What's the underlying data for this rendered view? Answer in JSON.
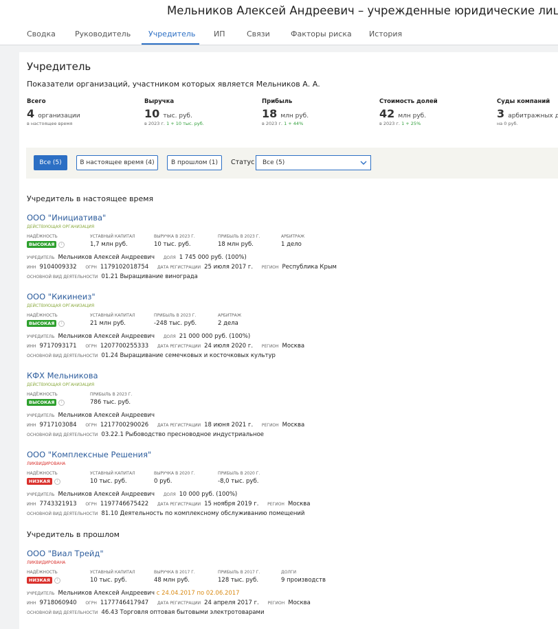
{
  "header": {
    "title": "Мельников Алексей Андреевич – учрежденные юридические лица"
  },
  "tabs": [
    {
      "label": "Сводка"
    },
    {
      "label": "Руководитель"
    },
    {
      "label": "Учредитель"
    },
    {
      "label": "ИП"
    },
    {
      "label": "Связи"
    },
    {
      "label": "Факторы риска"
    },
    {
      "label": "История"
    }
  ],
  "section": {
    "title": "Учредитель",
    "subtitle": "Показатели организаций, участником которых является Мельников А. А."
  },
  "stats": [
    {
      "label": "Всего",
      "value": "4",
      "unit": "организации",
      "note": "в настоящее время",
      "note_green": ""
    },
    {
      "label": "Выручка",
      "value": "10",
      "unit": "тыс. руб.",
      "note": "в 2023 г.",
      "note_green": "1 + 10 тыс. руб."
    },
    {
      "label": "Прибыль",
      "value": "18",
      "unit": "млн руб.",
      "note": "в 2023 г.",
      "note_green": "1 + 44%"
    },
    {
      "label": "Стоимость долей",
      "value": "42",
      "unit": "млн руб.",
      "note": "в 2023 г.",
      "note_green": "1 + 25%"
    },
    {
      "label": "Суды компаний",
      "value": "3",
      "unit": "арбитражных дела",
      "note": "на 0 руб.",
      "note_green": ""
    }
  ],
  "filters": {
    "buttons": [
      {
        "label": "Все (5)"
      },
      {
        "label": "В настоящее время (4)"
      },
      {
        "label": "В прошлом (1)"
      }
    ],
    "status_label": "Статус",
    "status_value": "Все (5)"
  },
  "headings": {
    "current": "Учредитель в настоящее время",
    "past": "Учредитель в прошлом"
  },
  "labels": {
    "reliability": "Надёжность",
    "capital": "Уставный капитал",
    "founder": "Учредитель",
    "share": "Доля",
    "inn": "ИНН",
    "ogrn": "ОГРН",
    "reg_date": "Дата регистрации",
    "region": "Регион",
    "activity": "Основной вид деятельности",
    "arbitration": "Арбитраж",
    "debts": "Долги"
  },
  "companies": [
    {
      "name": "ООО \"Инициатива\"",
      "status": "Действующая организация",
      "reliability": "Высокая",
      "capital": "1,7 млн руб.",
      "rev_label": "Выручка в 2023 г.",
      "revenue": "10 тыс. руб.",
      "profit_label": "Прибыль в 2023 г.",
      "profit": "18 млн руб.",
      "extra_value": "1 дело",
      "founder": "Мельников Алексей Андреевич",
      "share": "1 745 000 руб. (100%)",
      "inn": "9104009332",
      "ogrn": "1179102018754",
      "reg_date": "25 июля 2017 г.",
      "region": "Республика Крым",
      "activity": "01.21 Выращивание винограда"
    },
    {
      "name": "ООО \"Кикинеиз\"",
      "status": "Действующая организация",
      "reliability": "Высокая",
      "capital": "21 млн руб.",
      "profit_label": "Прибыль в 2023 г.",
      "profit": "-248 тыс. руб.",
      "extra_value": "2 дела",
      "founder": "Мельников Алексей Андреевич",
      "share": "21 000 000 руб. (100%)",
      "inn": "9717093171",
      "ogrn": "1207700255333",
      "reg_date": "24 июля 2020 г.",
      "region": "Москва",
      "activity": "01.24 Выращивание семечковых и косточковых культур"
    },
    {
      "name": "КФХ Мельникова",
      "status": "Действующая организация",
      "reliability": "Высокая",
      "profit_label": "Прибыль в 2023 г.",
      "profit": "786 тыс. руб.",
      "founder": "Мельников Алексей Андреевич",
      "inn": "9717103084",
      "ogrn": "1217700290026",
      "reg_date": "18 июня 2021 г.",
      "region": "Москва",
      "activity": "03.22.1 Рыбоводство пресноводное индустриальное"
    },
    {
      "name": "ООО \"Комплексные Решения\"",
      "status": "Ликвидирована",
      "reliability": "Низкая",
      "capital": "10 тыс. руб.",
      "rev_label": "Выручка в 2020 г.",
      "revenue": "0 руб.",
      "profit_label": "Прибыль в 2020 г.",
      "profit": "-8,0 тыс. руб.",
      "founder": "Мельников Алексей Андреевич",
      "share": "10 000 руб. (100%)",
      "inn": "7743321913",
      "ogrn": "1197746675422",
      "reg_date": "15 ноября 2019 г.",
      "region": "Москва",
      "activity": "81.10 Деятельность по комплексному обслуживанию помещений"
    },
    {
      "name": "ООО \"Виал Трейд\"",
      "status": "Ликвидирована",
      "reliability": "Низкая",
      "capital": "10 тыс. руб.",
      "rev_label": "Выручка в 2017 г.",
      "revenue": "48 млн руб.",
      "profit_label": "Прибыль в 2017 г.",
      "profit": "128 тыс. руб.",
      "extra_value": "9 производств",
      "founder": "Мельников Алексей Андреевич",
      "founder_period": "с 24.04.2017 по 02.06.2017",
      "inn": "9718060940",
      "ogrn": "1177746417947",
      "reg_date": "24 апреля 2017 г.",
      "region": "Москва",
      "activity": "46.43 Торговля оптовая бытовыми электротоварами"
    }
  ]
}
